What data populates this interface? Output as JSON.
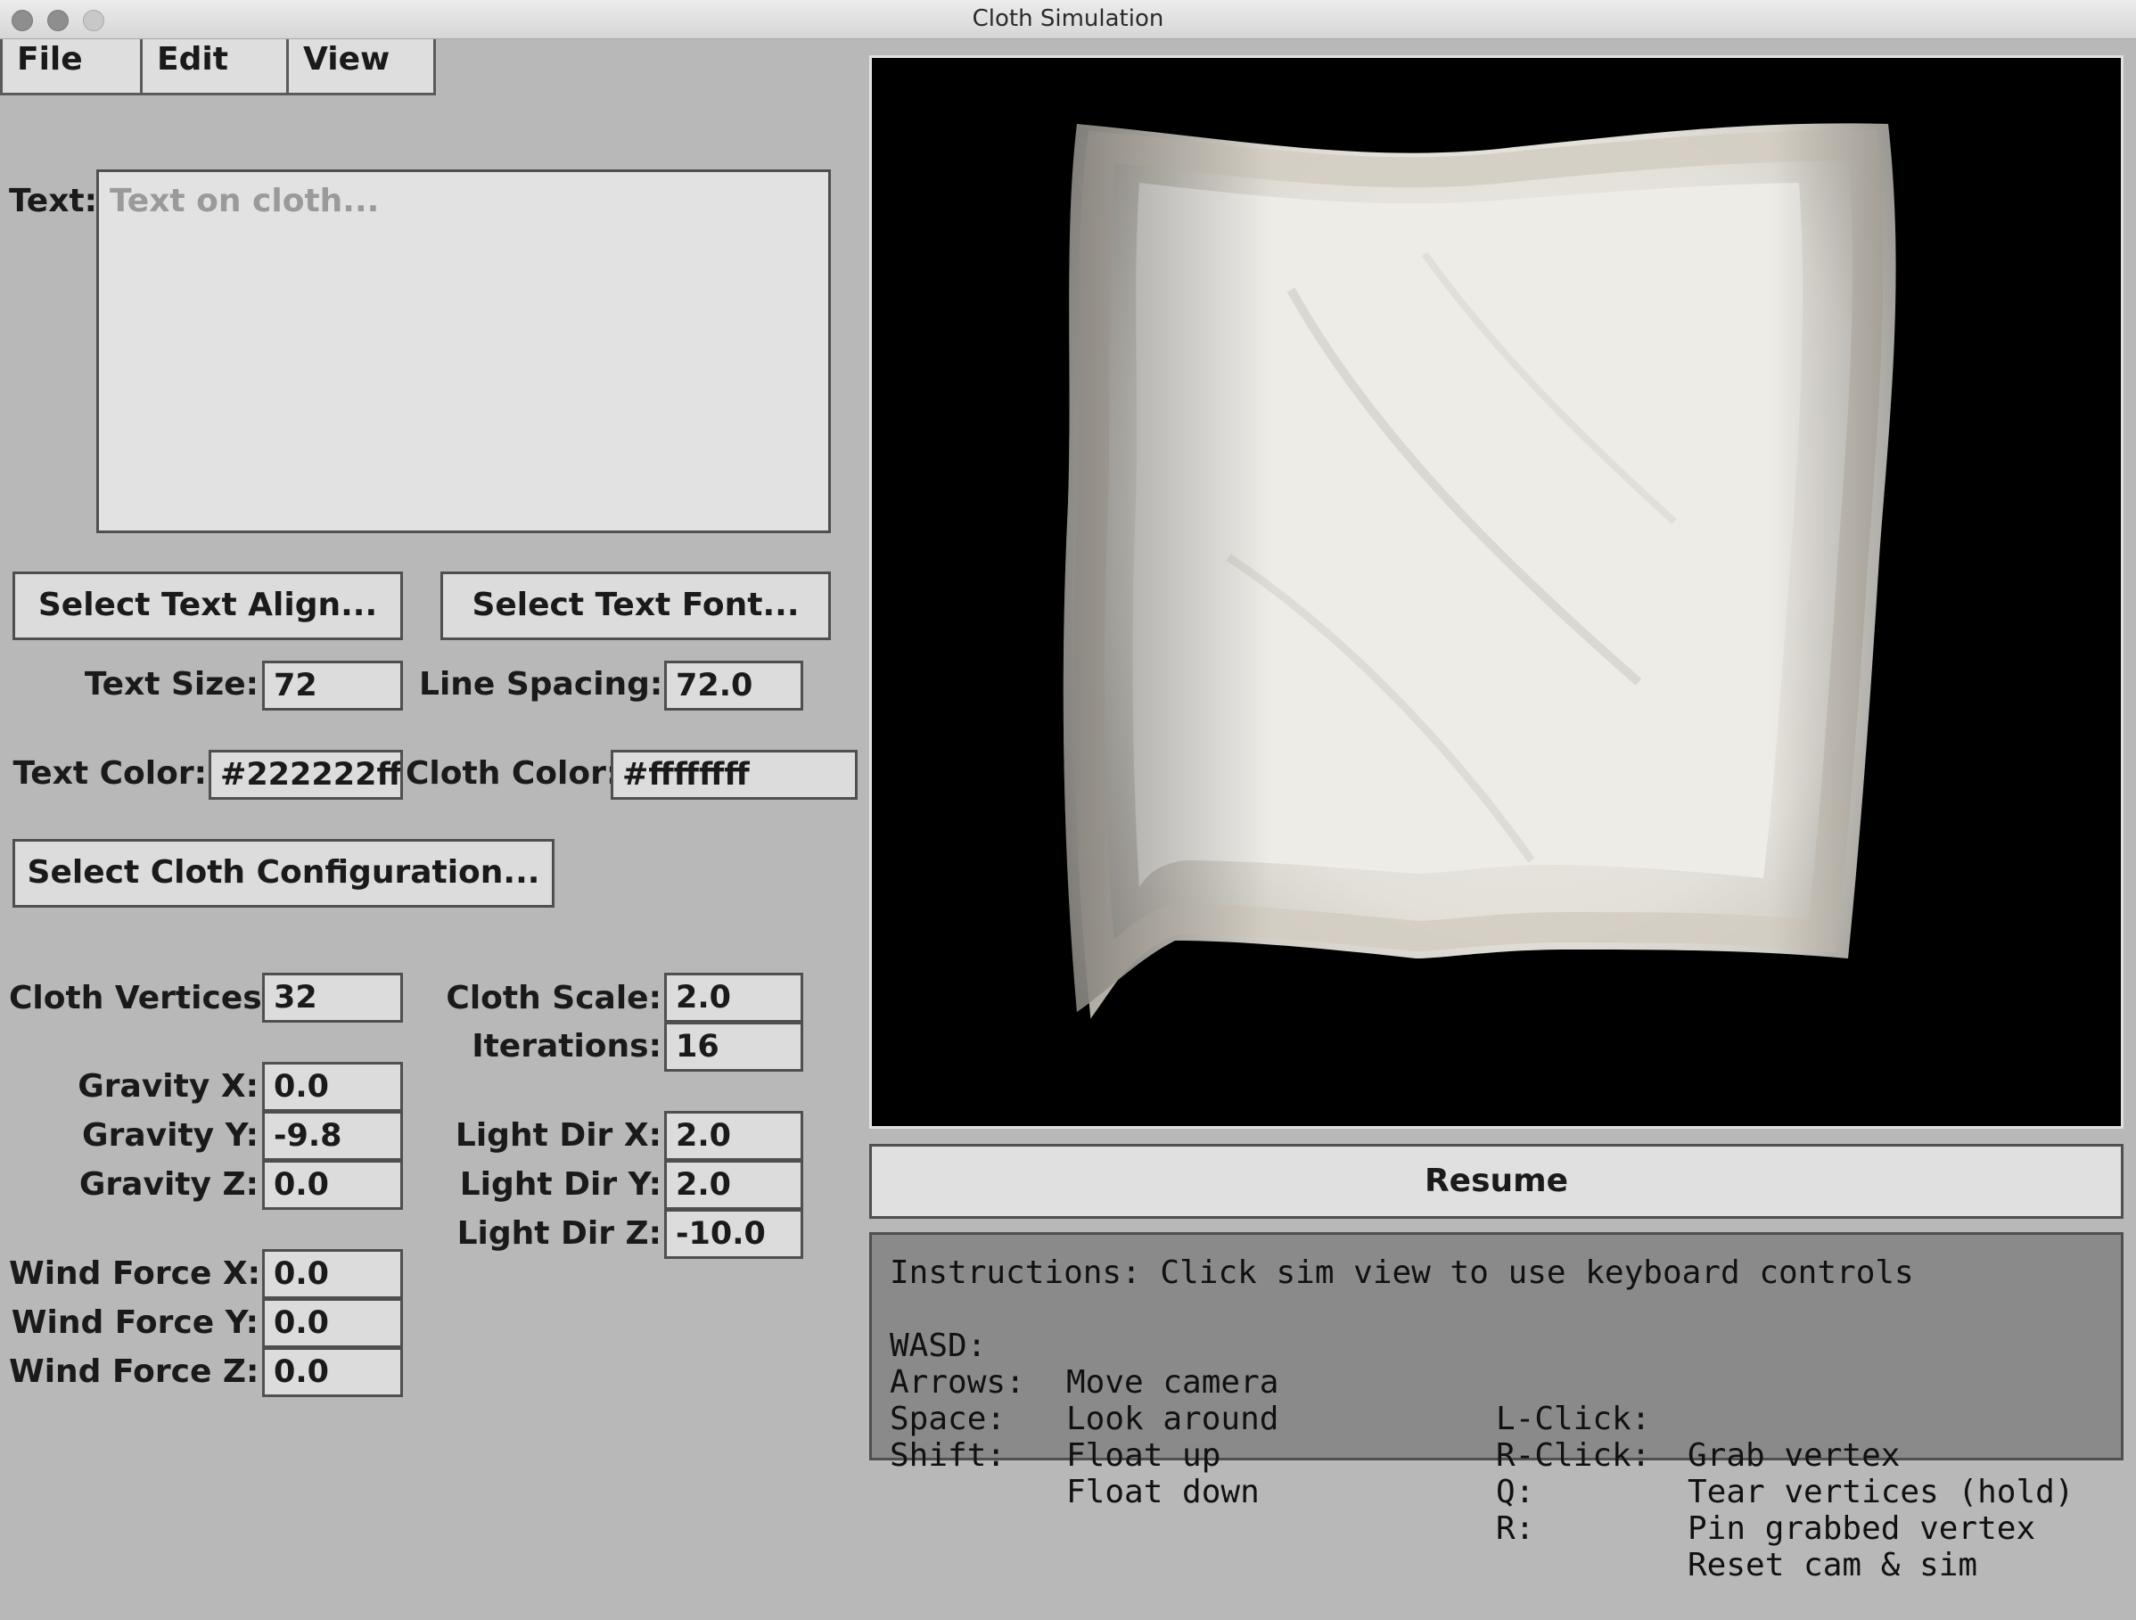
{
  "window": {
    "title": "Cloth Simulation"
  },
  "menu": {
    "file": "File",
    "edit": "Edit",
    "view": "View"
  },
  "text_input": {
    "label": "Text:",
    "placeholder": "Text on cloth..."
  },
  "buttons": {
    "select_text_align": "Select Text Align...",
    "select_text_font": "Select Text Font...",
    "select_cloth_configuration": "Select Cloth Configuration...",
    "resume": "Resume"
  },
  "fields": {
    "text_size": {
      "label": "Text Size:",
      "value": "72"
    },
    "line_spacing": {
      "label": "Line Spacing:",
      "value": "72.0"
    },
    "text_color": {
      "label": "Text Color:",
      "value": "#222222ff"
    },
    "cloth_color": {
      "label": "Cloth Color:",
      "value": "#ffffffff"
    },
    "cloth_vertices": {
      "label": "Cloth Vertices:",
      "value": "32"
    },
    "cloth_scale": {
      "label": "Cloth Scale:",
      "value": "2.0"
    },
    "iterations": {
      "label": "Iterations:",
      "value": "16"
    },
    "gravity_x": {
      "label": "Gravity X:",
      "value": "0.0"
    },
    "gravity_y": {
      "label": "Gravity Y:",
      "value": "-9.8"
    },
    "gravity_z": {
      "label": "Gravity Z:",
      "value": "0.0"
    },
    "light_dir_x": {
      "label": "Light Dir X:",
      "value": "2.0"
    },
    "light_dir_y": {
      "label": "Light Dir Y:",
      "value": "2.0"
    },
    "light_dir_z": {
      "label": "Light Dir Z:",
      "value": "-10.0"
    },
    "wind_force_x": {
      "label": "Wind Force X:",
      "value": "0.0"
    },
    "wind_force_y": {
      "label": "Wind Force Y:",
      "value": "0.0"
    },
    "wind_force_z": {
      "label": "Wind Force Z:",
      "value": "0.0"
    }
  },
  "instructions": {
    "header": "Instructions: Click sim view to use keyboard controls",
    "rows": [
      {
        "key": "WASD:",
        "action": "Move camera",
        "key2": "L-Click:",
        "action2": "Grab vertex"
      },
      {
        "key": "Arrows:",
        "action": "Look around",
        "key2": "R-Click:",
        "action2": "Tear vertices (hold)"
      },
      {
        "key": "Space:",
        "action": "Float up",
        "key2": "Q:",
        "action2": "Pin grabbed vertex"
      },
      {
        "key": "Shift:",
        "action": "Float down",
        "key2": "R:",
        "action2": "Reset cam & sim"
      }
    ]
  },
  "colors": {
    "panel_bg": "#b8b8b8",
    "sim_bg": "#000000",
    "cloth": "#e9e7e1",
    "cloth_border": "#d6d1c6"
  },
  "icons": [
    "close-icon",
    "minimize-icon",
    "zoom-icon"
  ]
}
